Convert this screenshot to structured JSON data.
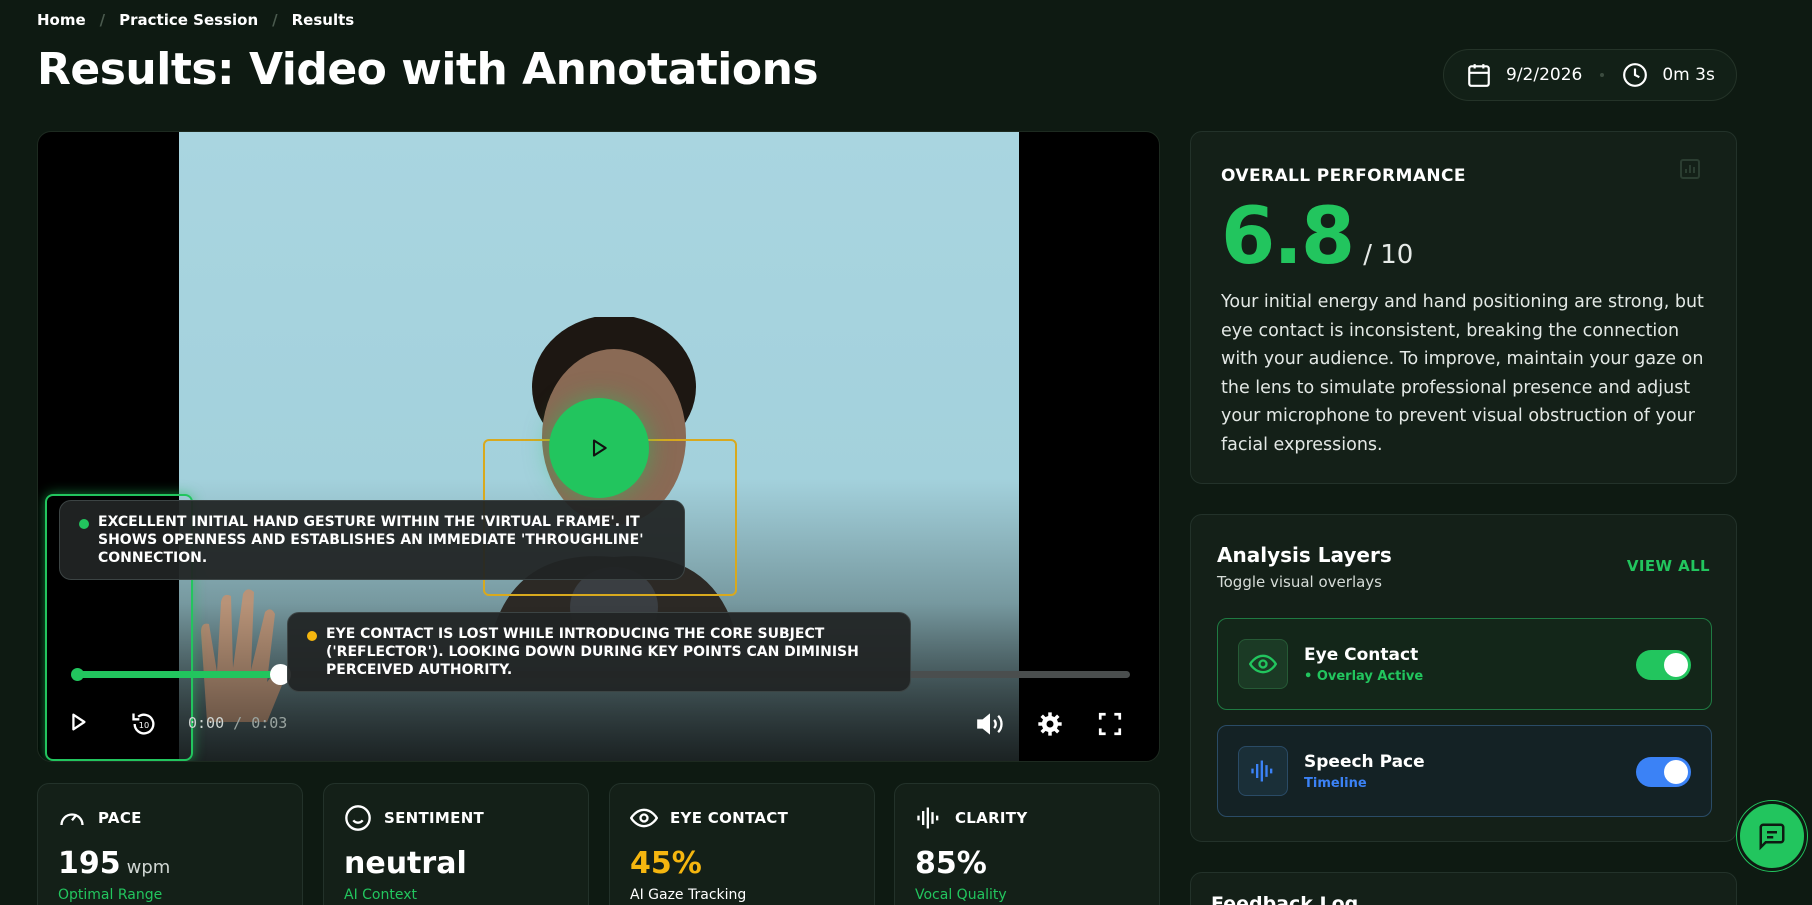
{
  "breadcrumb": [
    "Home",
    "Practice Session",
    "Results"
  ],
  "page_title": "Results: Video with Annotations",
  "meta": {
    "date": "9/2/2026",
    "duration": "0m 3s"
  },
  "video": {
    "current_time": "0:00",
    "total_time": "0:03",
    "time_separator": "/",
    "progress": 0.2,
    "annotations": [
      {
        "text": "Excellent initial hand gesture within the 'virtual frame'. It shows openness and establishes an immediate 'throughline' connection.",
        "color": "#22c55e"
      },
      {
        "text": "Eye contact is lost while introducing the core subject ('Reflector'). Looking down during key points can diminish perceived authority.",
        "color": "#f5b60f"
      }
    ]
  },
  "metrics": [
    {
      "label": "PACE",
      "value": "195",
      "unit": "wpm",
      "sub": "Optimal Range",
      "value_color": "#ffffff",
      "sub_color": "#22c55e",
      "icon": "speedometer-icon"
    },
    {
      "label": "SENTIMENT",
      "value": "neutral",
      "unit": "",
      "sub": "AI Context",
      "value_color": "#ffffff",
      "sub_color": "#22c55e",
      "icon": "smile-icon"
    },
    {
      "label": "EYE CONTACT",
      "value": "45%",
      "unit": "",
      "sub": "AI Gaze Tracking",
      "value_color": "#f5b60f",
      "sub_color": "#ffffff",
      "icon": "eye-icon"
    },
    {
      "label": "CLARITY",
      "value": "85%",
      "unit": "",
      "sub": "Vocal Quality",
      "value_color": "#ffffff",
      "sub_color": "#22c55e",
      "icon": "waveform-icon"
    }
  ],
  "performance": {
    "label": "OVERALL PERFORMANCE",
    "score": "6.8",
    "denominator": "/ 10",
    "summary": "Your initial energy and hand positioning are strong, but eye contact is inconsistent, breaking the connection with your audience. To improve, maintain your gaze on the lens to simulate professional presence and adjust your microphone to prevent visual obstruction of your facial expressions."
  },
  "layers": {
    "title": "Analysis Layers",
    "subtitle": "Toggle visual overlays",
    "view_all": "VIEW ALL",
    "items": [
      {
        "name": "Eye Contact",
        "status": "• Overlay Active",
        "color": "#22c55e",
        "enabled": true,
        "icon": "eye-icon"
      },
      {
        "name": "Speech Pace",
        "status": "Timeline",
        "color": "#3b82f6",
        "enabled": true,
        "icon": "waveform-icon"
      }
    ]
  },
  "feedback_log": {
    "title": "Feedback Log"
  }
}
